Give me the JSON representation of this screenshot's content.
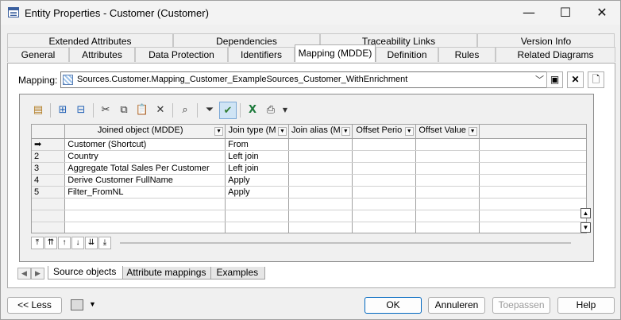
{
  "window": {
    "title": "Entity Properties - Customer (Customer)",
    "controls": {
      "minimize": "—",
      "maximize": "☐",
      "close": "✕"
    }
  },
  "tabs_row1": [
    "Extended Attributes",
    "Dependencies",
    "Traceability Links",
    "Version Info"
  ],
  "tabs_row2": [
    "General",
    "Attributes",
    "Data Protection",
    "Identifiers",
    "Mapping (MDDE)",
    "Definition",
    "Rules",
    "Related Diagrams"
  ],
  "active_tab": "Mapping (MDDE)",
  "mapping": {
    "label": "Mapping:",
    "value": "Sources.Customer.Mapping_Customer_ExampleSources_Customer_WithEnrichment",
    "icons": [
      "mapping-icon",
      "chevron-down-icon",
      "properties-icon",
      "delete-icon",
      "new-icon"
    ]
  },
  "toolbar": {
    "icons": [
      "properties-icon",
      "insert-row-icon",
      "add-row-icon",
      "cut-icon",
      "copy-icon",
      "paste-icon",
      "delete-icon",
      "find-icon",
      "filter-icon",
      "customize-columns-icon",
      "excel-icon",
      "print-icon",
      "dropdown-icon"
    ]
  },
  "grid": {
    "columns": [
      "Joined object (MDDE)",
      "Join type (M",
      "Join alias (M",
      "Offset Perio",
      "Offset Value"
    ],
    "rows": [
      {
        "marker": "➡",
        "joined_object": "Customer (Shortcut)",
        "join_type": "From"
      },
      {
        "marker": "2",
        "joined_object": "Country",
        "join_type": "Left join"
      },
      {
        "marker": "3",
        "joined_object": "Aggregate Total Sales Per Customer",
        "join_type": "Left join"
      },
      {
        "marker": "4",
        "joined_object": "Derive Customer FullName",
        "join_type": "Apply"
      },
      {
        "marker": "5",
        "joined_object": "Filter_FromNL",
        "join_type": "Apply"
      }
    ]
  },
  "nav": {
    "icons": [
      "move-to-top-icon",
      "move-up-page-icon",
      "move-up-icon",
      "move-down-icon",
      "move-down-page-icon",
      "move-to-bottom-icon"
    ]
  },
  "subtabs": [
    "Source objects",
    "Attribute mappings",
    "Examples"
  ],
  "active_subtab": "Source objects",
  "buttons": {
    "less": "<< Less",
    "ok": "OK",
    "cancel": "Annuleren",
    "apply": "Toepassen",
    "help": "Help"
  }
}
